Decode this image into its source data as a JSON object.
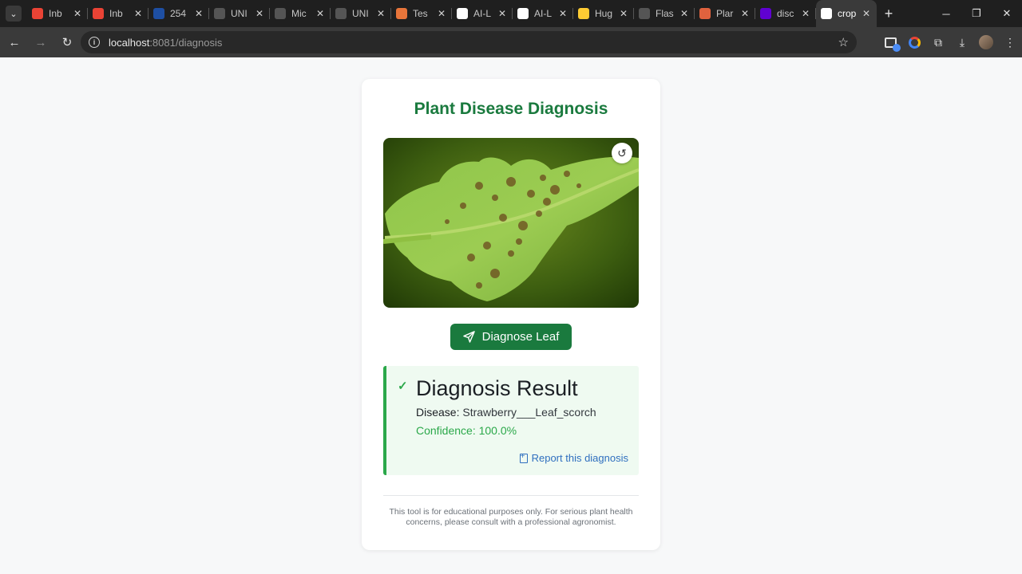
{
  "browser": {
    "tabs": [
      {
        "title": "Inb",
        "fav": "gmail-icon",
        "color": "#ea4335"
      },
      {
        "title": "Inb",
        "fav": "gmail-icon",
        "color": "#ea4335"
      },
      {
        "title": "254",
        "fav": "un-icon",
        "color": "#1e4fa3"
      },
      {
        "title": "UNI",
        "fav": "globe-icon",
        "color": "#555555"
      },
      {
        "title": "Mic",
        "fav": "globe-icon",
        "color": "#555555"
      },
      {
        "title": "UNI",
        "fav": "globe-icon",
        "color": "#555555"
      },
      {
        "title": "Tes",
        "fav": "orange-icon",
        "color": "#e8753a"
      },
      {
        "title": "AI-L",
        "fav": "github-icon",
        "color": "#ffffff"
      },
      {
        "title": "AI-L",
        "fav": "github-icon",
        "color": "#ffffff"
      },
      {
        "title": "Hug",
        "fav": "huggingface-icon",
        "color": "#ffcc33"
      },
      {
        "title": "Flas",
        "fav": "globe-icon",
        "color": "#555555"
      },
      {
        "title": "Plar",
        "fav": "claude-icon",
        "color": "#e0623e"
      },
      {
        "title": "disc",
        "fav": "yahoo-icon",
        "color": "#6001d2"
      },
      {
        "title": "crop",
        "fav": "heart-icon",
        "color": "#ffffff"
      }
    ],
    "url_host": "localhost",
    "url_rest": ":8081/diagnosis"
  },
  "page": {
    "title": "Plant Disease Diagnosis",
    "diagnose_button": "Diagnose Leaf",
    "result": {
      "heading": "Diagnosis Result",
      "disease_label": "Disease:",
      "disease_value": "Strawberry___Leaf_scorch",
      "confidence_label": "Confidence:",
      "confidence_value": "100.0%",
      "report_link": "Report this diagnosis"
    },
    "disclaimer": "This tool is for educational purposes only. For serious plant health concerns, please consult with a professional agronomist."
  },
  "colors": {
    "brand_green": "#1a7a3e",
    "success_green": "#2ba84a",
    "link_blue": "#2f6fbf"
  }
}
